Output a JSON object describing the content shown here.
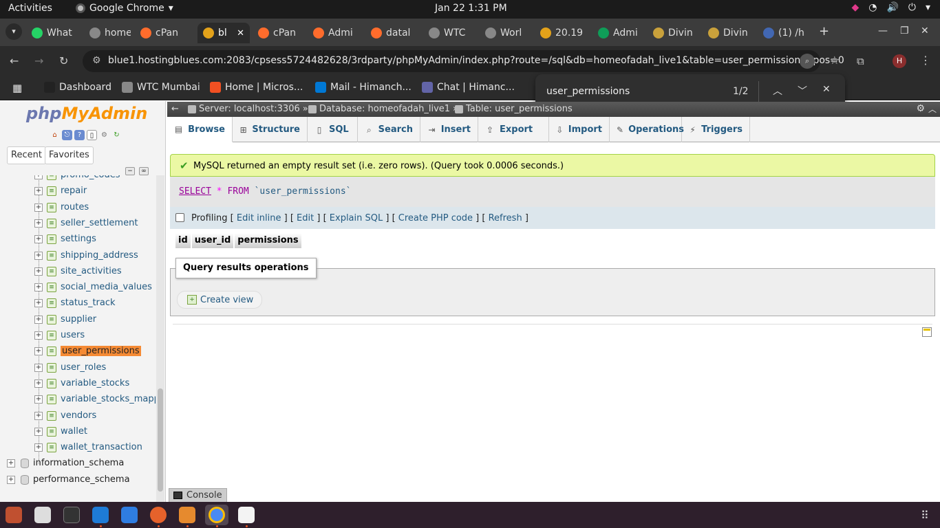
{
  "system": {
    "activities": "Activities",
    "app_name": "Google Chrome",
    "clock": "Jan 22   1:31 PM"
  },
  "tabs": [
    {
      "label": "What",
      "color": "#25d366"
    },
    {
      "label": "home",
      "color": "#888888"
    },
    {
      "label": "cPan",
      "color": "#ff6c2c"
    },
    {
      "label": "bl",
      "color": "#e3a21a",
      "active": true
    },
    {
      "label": "cPan",
      "color": "#ff6c2c"
    },
    {
      "label": "Admi",
      "color": "#ff6c2c"
    },
    {
      "label": "datal",
      "color": "#ff6c2c"
    },
    {
      "label": "WTC",
      "color": "#888888"
    },
    {
      "label": "Worl",
      "color": "#888888"
    },
    {
      "label": "20.19",
      "color": "#e3a21a"
    },
    {
      "label": "Admi",
      "color": "#0f9d58"
    },
    {
      "label": "Divin",
      "color": "#c9a13b"
    },
    {
      "label": "Divin",
      "color": "#c9a13b"
    },
    {
      "label": "(1) /h",
      "color": "#4267b2"
    }
  ],
  "omnibox": {
    "url": "blue1.hostingblues.com:2083/cpsess5724482628/3rdparty/phpMyAdmin/index.php?route=/sql&db=homeofadah_live1&table=user_permissions&pos=0"
  },
  "profile_initial": "H",
  "bookmarks": [
    {
      "label": "Dashboard",
      "color": "#222222"
    },
    {
      "label": "WTC Mumbai",
      "color": "#888888"
    },
    {
      "label": "Home | Micros...",
      "color": "#f25022"
    },
    {
      "label": "Mail - Himanch...",
      "color": "#0078d4"
    },
    {
      "label": "Chat | Himanc...",
      "color": "#6264a7"
    }
  ],
  "findbar": {
    "query": "user_permissions",
    "count": "1/2"
  },
  "pma": {
    "logo_php": "php",
    "logo_myadmin": "MyAdmin",
    "recent_label": "Recent",
    "favorites_label": "Favorites",
    "tables": [
      "promo_codes",
      "repair",
      "routes",
      "seller_settlement",
      "settings",
      "shipping_address",
      "site_activities",
      "social_media_values",
      "status_track",
      "supplier",
      "users",
      "user_permissions",
      "user_roles",
      "variable_stocks",
      "variable_stocks_mappin",
      "vendors",
      "wallet",
      "wallet_transaction"
    ],
    "databases": [
      "information_schema",
      "performance_schema"
    ],
    "breadcrumb": {
      "server": "Server: localhost:3306",
      "database": "Database: homeofadah_live1",
      "table": "Table: user_permissions"
    },
    "menu": [
      "Browse",
      "Structure",
      "SQL",
      "Search",
      "Insert",
      "Export",
      "Import",
      "Operations",
      "Triggers"
    ],
    "success_message": "MySQL returned an empty result set (i.e. zero rows). (Query took 0.0006 seconds.)",
    "sql": {
      "select": "SELECT",
      "star": "*",
      "from": "FROM",
      "table": "`user_permissions`"
    },
    "profiling": {
      "label": "Profiling",
      "edit_inline": "Edit inline",
      "edit": "Edit",
      "explain": "Explain SQL",
      "php": "Create PHP code",
      "refresh": "Refresh"
    },
    "columns": [
      "id",
      "user_id",
      "permissions"
    ],
    "ops_legend": "Query results operations",
    "create_view": "Create view",
    "console": "Console"
  },
  "colors": {
    "accent": "#f58a34",
    "link": "#235a81",
    "success_bg": "#ebf8a4"
  }
}
